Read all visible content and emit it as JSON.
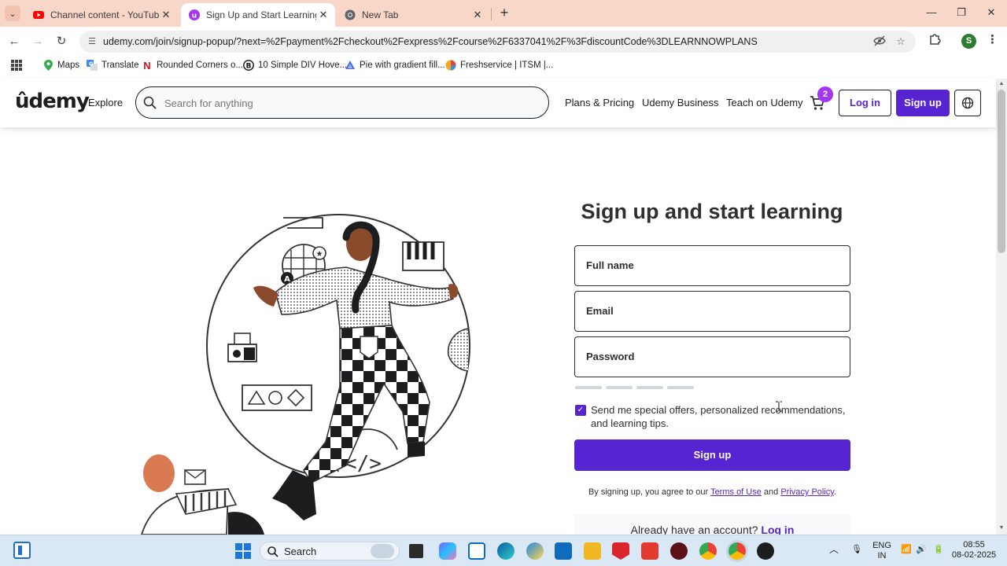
{
  "browser": {
    "tabs": [
      {
        "title": "Channel content - YouTube Studio",
        "favicon": "youtube-icon",
        "active": false
      },
      {
        "title": "Sign Up and Start Learning | Udemy",
        "favicon": "udemy-icon",
        "active": true
      },
      {
        "title": "New Tab",
        "favicon": "chrome-icon",
        "active": false
      }
    ],
    "new_tab_label": "+",
    "url": "udemy.com/join/signup-popup/?next=%2Fpayment%2Fcheckout%2Fexpress%2Fcourse%2F6337041%2F%3FdiscountCode%3DLEARNNOWPLANS",
    "profile_initial": "S",
    "bookmarks": [
      {
        "label": "Maps",
        "icon": "maps-icon"
      },
      {
        "label": "Translate",
        "icon": "translate-icon"
      },
      {
        "label": "Rounded Corners o...",
        "icon": "netflix-n-icon"
      },
      {
        "label": "10 Simple DIV Hove...",
        "icon": "b-circle-icon"
      },
      {
        "label": "Pie with gradient fill...",
        "icon": "codepen-icon"
      },
      {
        "label": "Freshservice | ITSM |...",
        "icon": "freshservice-icon"
      }
    ]
  },
  "site": {
    "logo": "ûdemy",
    "explore": "Explore",
    "search_placeholder": "Search for anything",
    "nav": {
      "plans_pricing": "Plans & Pricing",
      "business": "Udemy Business",
      "teach": "Teach on Udemy"
    },
    "cart_count": "2",
    "login_label": "Log in",
    "signup_label": "Sign up"
  },
  "form": {
    "title": "Sign up and start learning",
    "full_name_label": "Full name",
    "email_label": "Email",
    "password_label": "Password",
    "offers_checkbox_label": "Send me special offers, personalized recommendations, and learning tips.",
    "offers_checked": true,
    "submit_label": "Sign up",
    "terms_prefix": "By signing up, you agree to our",
    "terms_link": "Terms of Use",
    "terms_and": "and",
    "privacy_link": "Privacy Policy",
    "terms_suffix": ".",
    "have_account_text": "Already have an account?",
    "have_account_link": "Log in"
  },
  "taskbar": {
    "search_label": "Search",
    "language": "ENG",
    "region": "IN",
    "time": "08:55",
    "date": "08-02-2025"
  },
  "colors": {
    "brand_purple": "#5624d0",
    "accent_purple": "#a435f0",
    "tab_strip": "#f8d6c8",
    "taskbar": "#d9e8f4"
  }
}
